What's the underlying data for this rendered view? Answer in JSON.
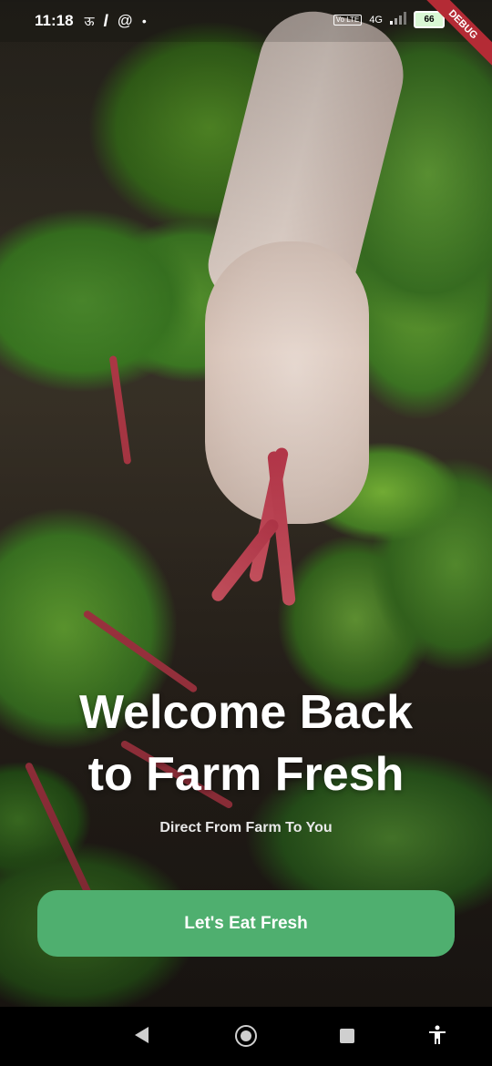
{
  "status_bar": {
    "time": "11:18",
    "left_icons": [
      "sim-text-icon",
      "l-app-icon",
      "at-sign-icon",
      "dot-icon"
    ],
    "network": "4G",
    "volte_label": "Vo LTE",
    "battery": "66",
    "debug_banner": "DEBUG"
  },
  "hero": {
    "title_line1": "Welcome Back",
    "title_line2": "to Farm Fresh",
    "subtitle": "Direct From Farm To You"
  },
  "cta": {
    "label": "Let's Eat Fresh",
    "color": "#4faf6f"
  },
  "nav_bar": {
    "items": [
      "back-icon",
      "home-icon",
      "recent-apps-icon",
      "accessibility-icon"
    ]
  }
}
